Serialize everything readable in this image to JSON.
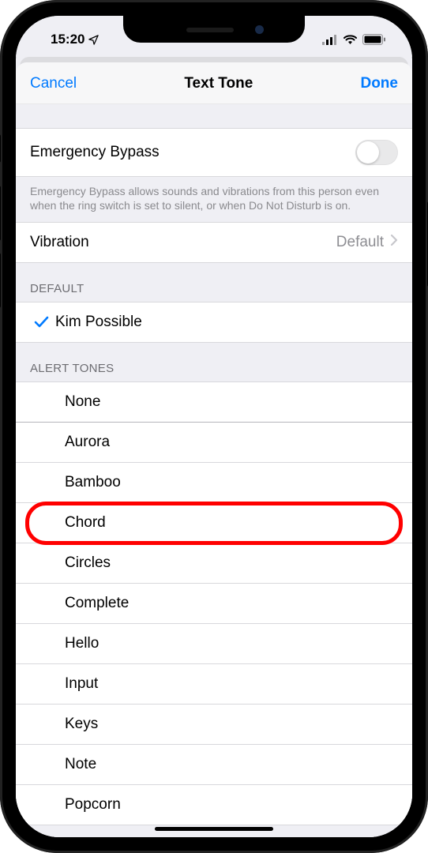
{
  "status": {
    "time": "15:20",
    "locationIcon": "location-arrow"
  },
  "nav": {
    "cancel": "Cancel",
    "title": "Text Tone",
    "done": "Done"
  },
  "emergency": {
    "label": "Emergency Bypass",
    "enabled": false,
    "footer": "Emergency Bypass allows sounds and vibrations from this person even when the ring switch is set to silent, or when Do Not Disturb is on."
  },
  "vibration": {
    "label": "Vibration",
    "value": "Default"
  },
  "sections": {
    "default": {
      "header": "DEFAULT",
      "item": "Kim Possible"
    },
    "alert": {
      "header": "ALERT TONES",
      "items": [
        "None",
        "Aurora",
        "Bamboo",
        "Chord",
        "Circles",
        "Complete",
        "Hello",
        "Input",
        "Keys",
        "Note",
        "Popcorn"
      ]
    }
  },
  "highlightIndex": 3
}
